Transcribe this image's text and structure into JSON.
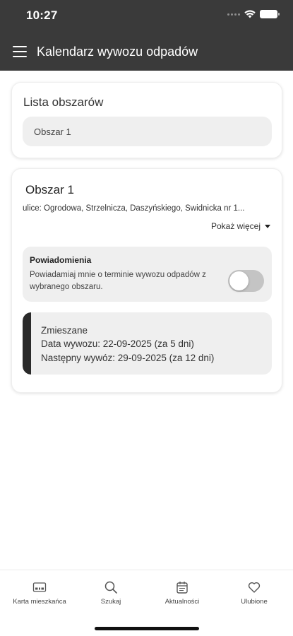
{
  "status_bar": {
    "time": "10:27"
  },
  "appbar": {
    "title": "Kalendarz wywozu odpadów"
  },
  "areas_list": {
    "title": "Lista obszarów",
    "selected": "Obszar 1"
  },
  "area": {
    "name": "Obszar 1",
    "streets": "ulice: Ogrodowa, Strzelnicza, Daszyńskiego, Świdnicka nr 1...",
    "show_more": "Pokaż więcej"
  },
  "notifications": {
    "title": "Powiadomienia",
    "description": "Powiadamiaj mnie o terminie wywozu odpadów z wybranego obszaru.",
    "enabled": false
  },
  "pickup": {
    "type": "Zmieszane",
    "date_line": "Data wywozu: 22-09-2025 (za 5 dni)",
    "next_line": "Następny wywóz: 29-09-2025 (za 12 dni)",
    "accent_color": "#2a2a2a"
  },
  "tabs": [
    {
      "label": "Karta mieszkańca",
      "icon": "id-card-icon"
    },
    {
      "label": "Szukaj",
      "icon": "search-icon"
    },
    {
      "label": "Aktualności",
      "icon": "calendar-icon"
    },
    {
      "label": "Ulubione",
      "icon": "heart-icon"
    }
  ],
  "colors": {
    "header_bg": "#3a3a3a",
    "card_bg": "#ffffff",
    "field_bg": "#efefef"
  }
}
